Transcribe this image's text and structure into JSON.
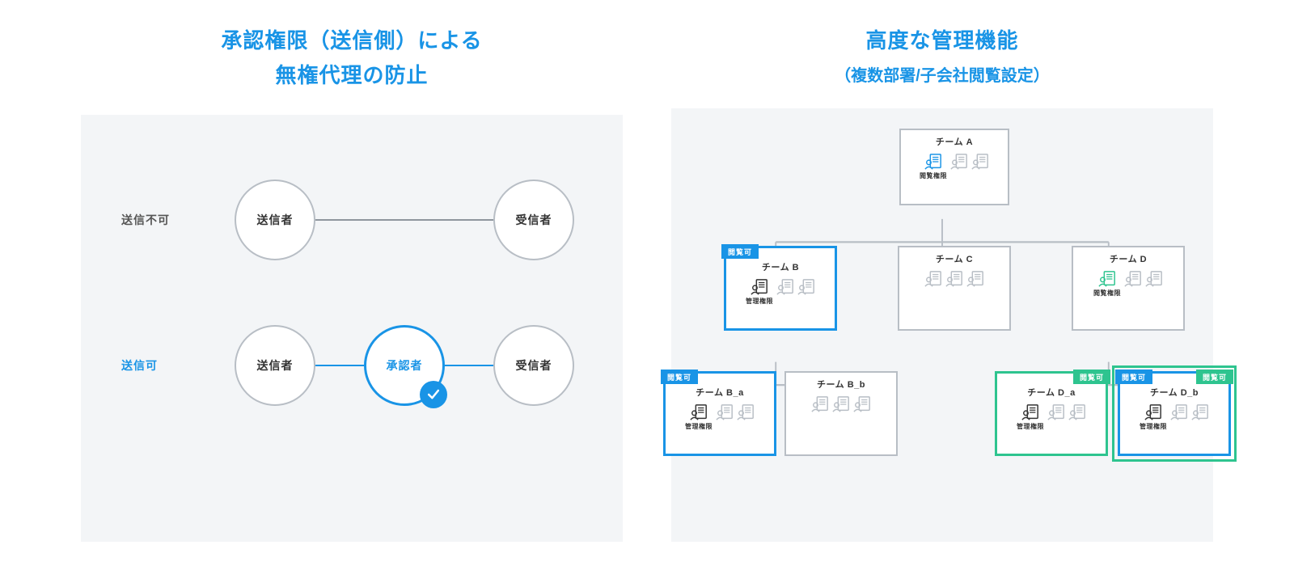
{
  "left": {
    "title_line1": "承認権限（送信側）による",
    "title_line2": "無権代理の防止",
    "row1": {
      "label": "送信不可",
      "sender": "送信者",
      "receiver": "受信者"
    },
    "row2": {
      "label": "送信可",
      "sender": "送信者",
      "approver": "承認者",
      "receiver": "受信者"
    }
  },
  "right": {
    "title": "高度な管理機能",
    "subtitle": "（複数部署/子会社閲覧設定）",
    "tag_view": "閲覧可",
    "role_view": "閲覧権限",
    "role_admin": "管理権限",
    "teams": {
      "A": {
        "name": "チーム A"
      },
      "B": {
        "name": "チーム B"
      },
      "C": {
        "name": "チーム C"
      },
      "D": {
        "name": "チーム D"
      },
      "Ba": {
        "name": "チーム B_a"
      },
      "Bb": {
        "name": "チーム B_b"
      },
      "Da": {
        "name": "チーム D_a"
      },
      "Db": {
        "name": "チーム D_b"
      }
    }
  }
}
